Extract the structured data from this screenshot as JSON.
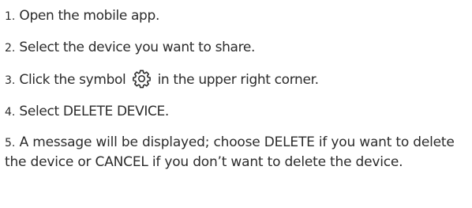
{
  "steps": [
    {
      "number": "1.",
      "text": "Open the mobile app."
    },
    {
      "number": "2.",
      "text": "Select the device you want to share."
    },
    {
      "number": "3.",
      "text_before": "Click the symbol",
      "icon": "gear-icon",
      "text_after": "in the upper right corner."
    },
    {
      "number": "4.",
      "text": "Select DELETE DEVICE."
    },
    {
      "number": "5.",
      "text": "A message will be displayed; choose DELETE if you want to delete the device or CANCEL if you don’t want to delete the device."
    }
  ]
}
